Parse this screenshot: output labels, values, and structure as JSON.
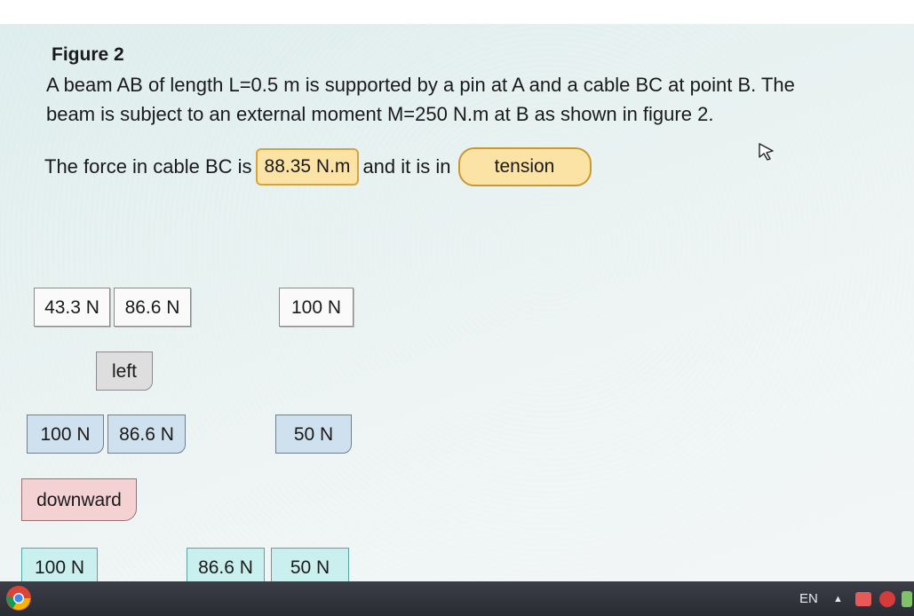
{
  "question": {
    "figure_title": "Figure 2",
    "problem_text": "A beam AB of length L=0.5 m is supported by a pin at A and a cable BC at point B. The beam is subject to an external moment M=250 N.m at B as shown in figure 2.",
    "answer_prefix": "The force in cable BC is",
    "answer_value": "88.35 N.m",
    "answer_middle": "and it is in",
    "answer_state": "tension"
  },
  "choices": {
    "c1": "43.3 N",
    "c2": "86.6 N",
    "c3": "100 N",
    "c4": "left",
    "c5": "100 N",
    "c6": "86.6 N",
    "c7": "50 N",
    "c8": "downward",
    "c9": "100 N",
    "c10": "86.6 N",
    "c11": "50 N"
  },
  "taskbar": {
    "language": "EN",
    "browser_icon": "chrome-icon",
    "tray_arrow": "▲"
  },
  "colors": {
    "answer_fill": "#fbe3a6",
    "chip_blue": "#cfe0ee",
    "chip_pink": "#f4d2d4",
    "chip_teal": "#c9efee",
    "taskbar": "#2f3139"
  }
}
